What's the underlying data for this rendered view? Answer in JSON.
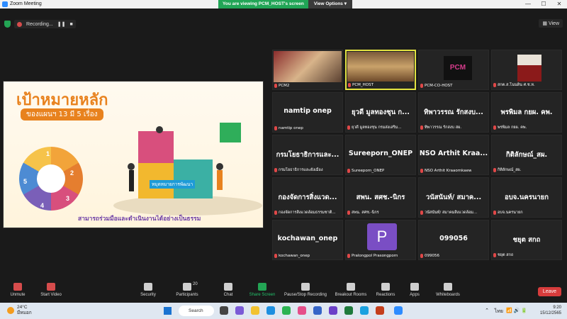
{
  "window": {
    "title": "Zoom Meeting"
  },
  "banner": {
    "viewing": "You are viewing PCM_HOST's screen",
    "view_options": "View Options ▾"
  },
  "recording": {
    "label": "Recording..."
  },
  "view_button": {
    "label": "View"
  },
  "slide": {
    "title": "เป้าหมายหลัก",
    "subtitle": "ของแผนฯ 13 มี 5 เรื่อง",
    "puzzle_label": "หมุดหมายการพัฒนา",
    "caption": "สามารถร่วมมือและดำเนินงานได้อย่างเป็นธรรม",
    "wheel_numbers": [
      "1",
      "2",
      "3",
      "4",
      "5"
    ]
  },
  "participants": [
    {
      "label": "PCM2",
      "big": "",
      "photo": true
    },
    {
      "label": "PCM_HOST",
      "big": "",
      "photo": true,
      "active": true
    },
    {
      "label": "PCM-CO-HOST",
      "big": "",
      "logo": "PCM"
    },
    {
      "label": "สกต.ส.โนนดิน ศ.ช.ห.",
      "big": "",
      "portrait": true
    },
    {
      "label": "namtip onep",
      "big": "namtip onep"
    },
    {
      "label": "ยุวดี มูลทองชุน กรมส่งเสริม...",
      "big": "ยุวดี มูลทองชุน ก..."
    },
    {
      "label": "ทิพาวรรณ รักสงบ สผ.",
      "big": "ทิพาวรรณ รักสงบ..."
    },
    {
      "label": "พรพิมล กยผ. คพ.",
      "big": "พรพิมล กยผ. คพ."
    },
    {
      "label": "กรมโยธาธิการและผังเมือง",
      "big": "กรมโยธาธิการและ..."
    },
    {
      "label": "Sureeporn_ONEP",
      "big": "Sureeporn_ONEP"
    },
    {
      "label": "NSO Arthit Kraaomkaew",
      "big": "NSO Arthit Kraa..."
    },
    {
      "label": "กิติลักษณ์_สผ.",
      "big": "กิติลักษณ์_สผ."
    },
    {
      "label": "กองจัดการสิ่งแวดล้อมธรรมชาติ...",
      "big": "กองจัดการสิ่งแวด..."
    },
    {
      "label": "สพน. สศช.-นิกร",
      "big": "สพน. สศช.-นิกร"
    },
    {
      "label": "วนัสนันท์/ สมาคมสิ่งแวดล้อม...",
      "big": "วนัสนันท์/ สมาค..."
    },
    {
      "label": "อบจ.นครนายก",
      "big": "อบจ.นครนายก"
    },
    {
      "label": "kochawan_onep",
      "big": "kochawan_onep"
    },
    {
      "label": "Pralongpol Prasongporn",
      "big": "",
      "avatar": "P"
    },
    {
      "label": "099056",
      "big": "099056"
    },
    {
      "label": "ชยุต สกถ",
      "big": "ชยุต สกถ"
    }
  ],
  "toolbar": {
    "unmute": "Unmute",
    "start_video": "Start Video",
    "security": "Security",
    "participants": "Participants",
    "participants_count": "20",
    "chat": "Chat",
    "share_screen": "Share Screen",
    "pause_recording": "Pause/Stop Recording",
    "breakout_rooms": "Breakout Rooms",
    "reactions": "Reactions",
    "apps": "Apps",
    "whiteboards": "Whiteboards",
    "leave": "Leave"
  },
  "taskbar": {
    "temp": "24°C",
    "weather": "มีหมอก",
    "search": "Search",
    "lang": "ไทย",
    "time": "9:20",
    "date": "15/12/2565"
  }
}
